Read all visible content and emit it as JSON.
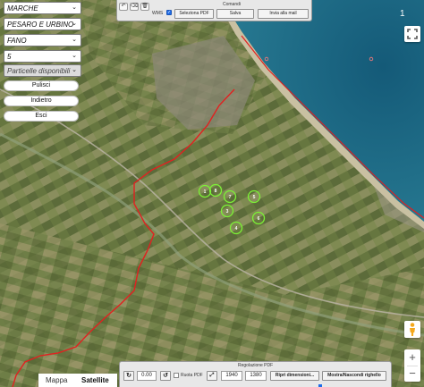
{
  "colors": {
    "sea": "#1d6a86",
    "beach": "#c9c0a2",
    "particle_circle": "#7cf236",
    "boundary_line": "#e22020",
    "checkbox_accent": "#1e6ce8"
  },
  "filters": {
    "region": "MARCHE",
    "province": "PESARO E URBINO",
    "municipality": "FANO",
    "sheet": "5",
    "particles_placeholder": "Particelle disponibili"
  },
  "actions": {
    "clear": "Pulisci",
    "back": "Indietro",
    "exit": "Esci"
  },
  "commands": {
    "title": "Comandi",
    "wms_label": "WMS",
    "wms_checked": true,
    "select_pdf": "Seleziona PDF",
    "save": "Salva",
    "send_mail": "Invia alla mail",
    "tool_icons": [
      "undo-icon",
      "eraser-icon",
      "trash-icon"
    ]
  },
  "page_number": "1",
  "map_type": {
    "map": "Mappa",
    "satellite": "Satellite",
    "active": "Satellite"
  },
  "pdf_settings": {
    "title": "Regolazione PDF",
    "rotation": "0.00",
    "rotate_pdf_label": "Ruota PDF",
    "width": "1940",
    "height": "1380",
    "reset_dimensions": "Ripri dimensioni...",
    "toggle_ruler": "Mostra/Nascondi righello"
  },
  "particles": [
    {
      "label": "1"
    },
    {
      "label": "8"
    },
    {
      "label": "7"
    },
    {
      "label": "5"
    },
    {
      "label": "3"
    },
    {
      "label": "6"
    },
    {
      "label": "4"
    }
  ],
  "zoom": {
    "in": "+",
    "out": "−"
  }
}
